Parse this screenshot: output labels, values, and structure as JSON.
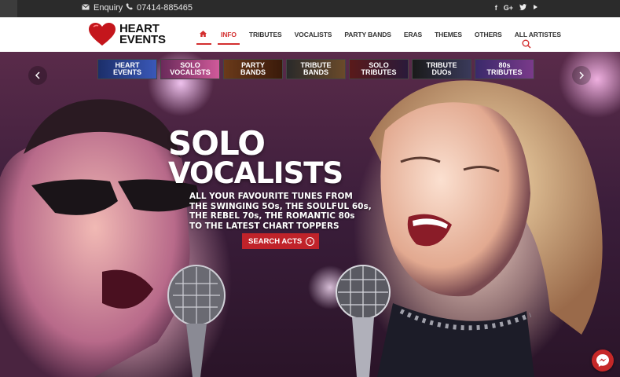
{
  "topbar": {
    "enquiry": "Enquiry",
    "phone": "07414-885465",
    "social": [
      "f",
      "G+",
      "twitter",
      "youtube"
    ]
  },
  "logo": {
    "line1": "HEART",
    "line2": "EVENTS"
  },
  "menu": [
    {
      "label": ""
    },
    {
      "label": "INFO"
    },
    {
      "label": "TRIBUTES"
    },
    {
      "label": "VOCALISTS"
    },
    {
      "label": "PARTY BANDS"
    },
    {
      "label": "ERAS"
    },
    {
      "label": "THEMES"
    },
    {
      "label": "OTHERS"
    },
    {
      "label": "ALL ARTISTES"
    }
  ],
  "thumbs": [
    {
      "line1": "HEART",
      "line2": "EVENTS"
    },
    {
      "line1": "SOLO",
      "line2": "VOCALISTS"
    },
    {
      "line1": "PARTY",
      "line2": "BANDS"
    },
    {
      "line1": "TRIBUTE",
      "line2": "BANDS"
    },
    {
      "line1": "SOLO",
      "line2": "TRIBUTES"
    },
    {
      "line1": "TRIBUTE",
      "line2": "DUOs"
    },
    {
      "line1": "80s",
      "line2": "TRIBUTES"
    }
  ],
  "hero": {
    "title_line1": "SOLO",
    "title_line2": "VOCALISTS",
    "tagline": [
      "ALL YOUR FAVOURITE TUNES FROM",
      "THE SWINGING 5Os, THE SOULFUL 60s,",
      "THE REBEL 70s, THE ROMANTIC 80s",
      "TO THE LATEST CHART TOPPERS"
    ],
    "cta": "SEARCH ACTS"
  },
  "colors": {
    "accent": "#d32f2f",
    "topbar": "#2b2b2b",
    "cta": "#c0232a"
  }
}
